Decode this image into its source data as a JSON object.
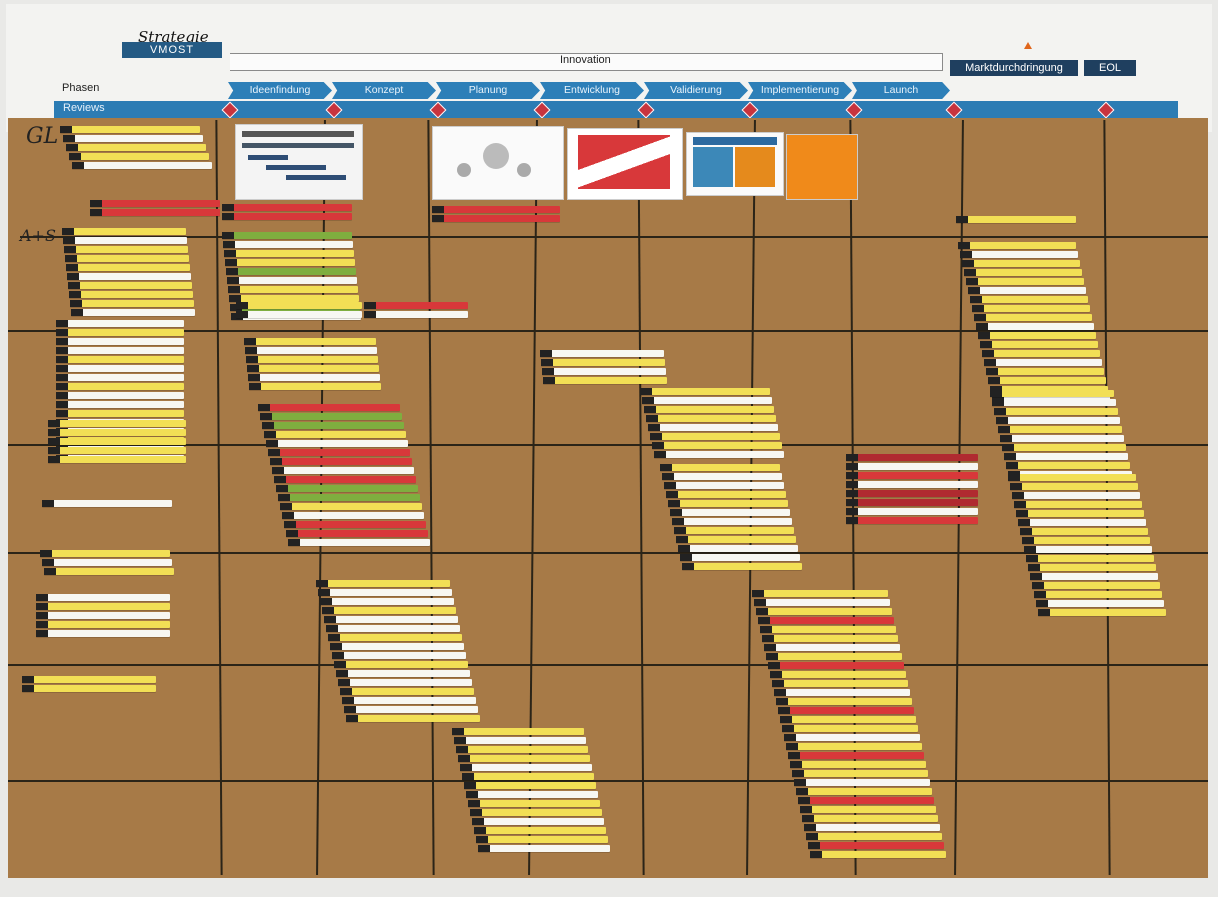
{
  "title_handwritten": "Strategie",
  "vmost_label": "VMOST",
  "innovation_label": "Innovation",
  "market_labels": [
    "Marktdurchdringung",
    "EOL"
  ],
  "phasen_label": "Phasen",
  "reviews_label": "Reviews",
  "row_labels": [
    "GL",
    "A+S"
  ],
  "phases": [
    {
      "label": "Ideenfindung"
    },
    {
      "label": "Konzept"
    },
    {
      "label": "Planung"
    },
    {
      "label": "Entwicklung"
    },
    {
      "label": "Validierung"
    },
    {
      "label": "Implementierung"
    },
    {
      "label": "Launch"
    }
  ],
  "colors": {
    "paper": "#a77a47",
    "phase_blue": "#2d7fb8",
    "header_dark": "#1f3f5f",
    "review_diamond": "#c8343e",
    "card_yellow": "#f2df55",
    "card_white": "#f7f7f2",
    "card_red": "#d8383a",
    "card_green": "#7fae3f"
  }
}
